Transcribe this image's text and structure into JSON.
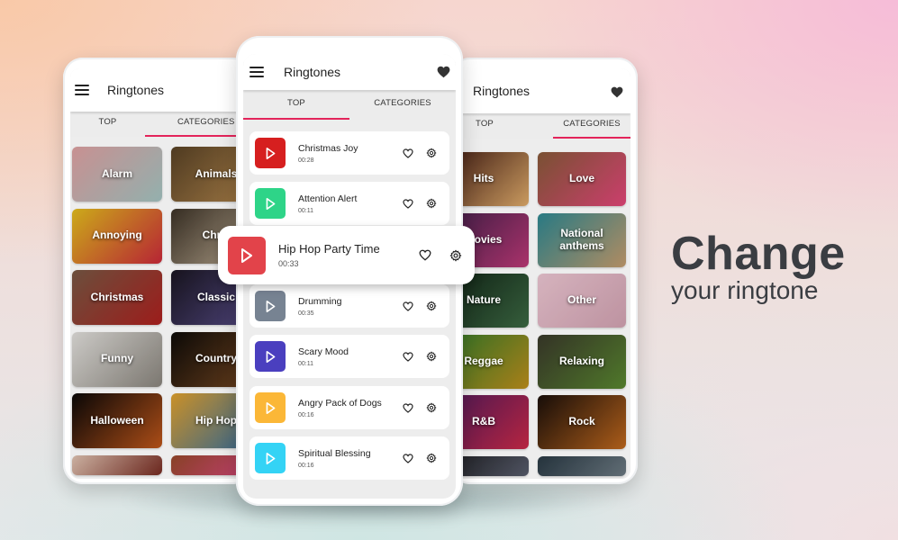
{
  "headline": {
    "line1": "Change",
    "line2": "your ringtone"
  },
  "app": {
    "title": "Ringtones",
    "tabs": [
      "TOP",
      "CATEGORIES"
    ],
    "accent_color": "#e3245a"
  },
  "left_phone": {
    "active_tab": "CATEGORIES",
    "categories": [
      {
        "label": "Alarm",
        "colors": [
          "#e4a5a6",
          "#a8c9c6"
        ]
      },
      {
        "label": "Animals",
        "colors": [
          "#5a4326",
          "#b88a4e"
        ]
      },
      {
        "label": "Annoying",
        "colors": [
          "#e8c21e",
          "#d02a3c"
        ]
      },
      {
        "label": "Christmas Joy",
        "display": "Chris",
        "colors": [
          "#3d3327",
          "#c9b79d"
        ]
      },
      {
        "label": "Christmas",
        "colors": [
          "#7a5a45",
          "#b3211f"
        ]
      },
      {
        "label": "Classic",
        "colors": [
          "#1a1622",
          "#5b4f8e"
        ]
      },
      {
        "label": "Funny",
        "colors": [
          "#e8e6e2",
          "#8d8880"
        ]
      },
      {
        "label": "Country",
        "colors": [
          "#0e0b08",
          "#7b4a22"
        ]
      },
      {
        "label": "Halloween",
        "colors": [
          "#0a0808",
          "#c4581a"
        ]
      },
      {
        "label": "Hip Hop",
        "colors": [
          "#e6a52e",
          "#2f6fa8"
        ]
      },
      {
        "label": "",
        "colors": [
          "#e7c9b7",
          "#7a2c22"
        ]
      },
      {
        "label": "",
        "colors": [
          "#9b4a2c",
          "#e04884"
        ]
      }
    ]
  },
  "center_phone": {
    "active_tab": "TOP",
    "ringtones": [
      {
        "title": "Christmas Joy",
        "duration": "00:28",
        "color": "#d61f1f"
      },
      {
        "title": "Attention Alert",
        "duration": "00:11",
        "color": "#2ed488"
      },
      {
        "title": "Drumming",
        "duration": "00:35",
        "color": "#778392"
      },
      {
        "title": "Scary Mood",
        "duration": "00:11",
        "color": "#4a3fbf"
      },
      {
        "title": "Angry Pack of Dogs",
        "duration": "00:16",
        "color": "#fbb737"
      },
      {
        "title": "Spiritual Blessing",
        "duration": "00:16",
        "color": "#34d3f5"
      }
    ],
    "highlighted": {
      "title": "Hip Hop Party Time",
      "duration": "00:33",
      "color": "#e2434a"
    }
  },
  "right_phone": {
    "active_tab": "CATEGORIES",
    "categories": [
      {
        "label": "Hits",
        "colors": [
          "#3b1510",
          "#e6b06d"
        ]
      },
      {
        "label": "Love",
        "colors": [
          "#8a5c3a",
          "#e8487c"
        ]
      },
      {
        "label": "Movies",
        "display": "Movies",
        "colors": [
          "#3d1f4a",
          "#c23a7a"
        ]
      },
      {
        "label": "National anthems",
        "colors": [
          "#2e8b96",
          "#c9a070"
        ]
      },
      {
        "label": "Nature",
        "colors": [
          "#0f2114",
          "#3e6c45"
        ]
      },
      {
        "label": "Other",
        "colors": [
          "#f3ccd8",
          "#d8a7b7"
        ]
      },
      {
        "label": "Reggae",
        "colors": [
          "#2c7d2c",
          "#c2921c"
        ]
      },
      {
        "label": "Relaxing",
        "colors": [
          "#3b3a2c",
          "#5b8a30"
        ]
      },
      {
        "label": "R&B",
        "colors": [
          "#4d1a5e",
          "#d02a4a"
        ]
      },
      {
        "label": "Rock",
        "colors": [
          "#1a0f0a",
          "#c46a1e"
        ]
      },
      {
        "label": "",
        "colors": [
          "#1b1b1e",
          "#5b6070"
        ]
      },
      {
        "label": "",
        "colors": [
          "#2a3a45",
          "#6f7d86"
        ]
      }
    ]
  }
}
